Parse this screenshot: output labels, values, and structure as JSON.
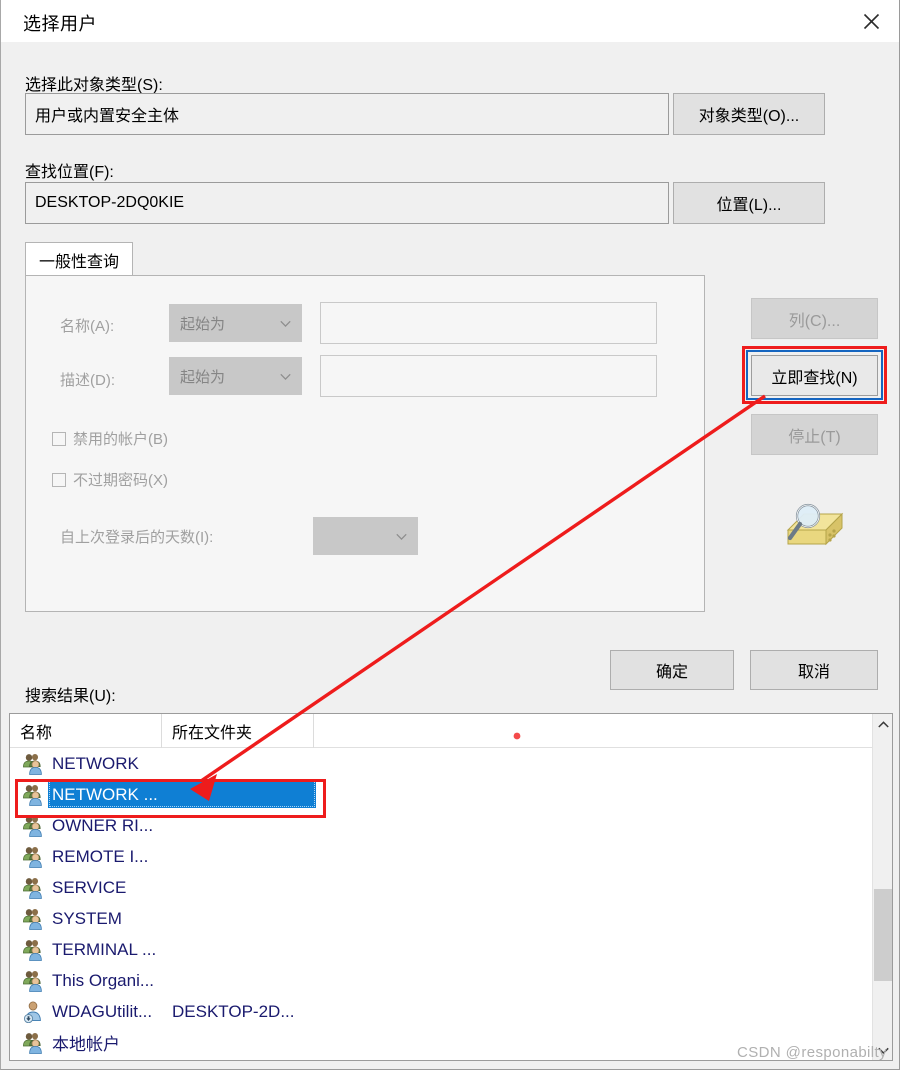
{
  "window": {
    "title": "选择用户",
    "close_icon": "close-icon"
  },
  "object_type": {
    "label": "选择此对象类型(S):",
    "value": "用户或内置安全主体",
    "button": "对象类型(O)..."
  },
  "location": {
    "label": "查找位置(F):",
    "value": "DESKTOP-2DQ0KIE",
    "button": "位置(L)..."
  },
  "query": {
    "tab": "一般性查询",
    "name_label": "名称(A):",
    "name_condition": "起始为",
    "name_value": "",
    "desc_label": "描述(D):",
    "desc_condition": "起始为",
    "desc_value": "",
    "disabled_accounts": "禁用的帐户(B)",
    "non_expiring_password": "不过期密码(X)",
    "days_since_logon_label": "自上次登录后的天数(I):",
    "days_since_logon_value": ""
  },
  "side_buttons": {
    "columns": "列(C)...",
    "find_now": "立即查找(N)",
    "stop": "停止(T)",
    "search_icon": "magnifier-search-icon"
  },
  "footer": {
    "ok": "确定",
    "cancel": "取消"
  },
  "results": {
    "label": "搜索结果(U):",
    "columns": [
      "名称",
      "所在文件夹"
    ],
    "rows": [
      {
        "name": "NETWORK",
        "folder": "",
        "icon": "group-icon",
        "selected": false
      },
      {
        "name": "NETWORK ...",
        "folder": "",
        "icon": "group-icon",
        "selected": true
      },
      {
        "name": "OWNER RI...",
        "folder": "",
        "icon": "group-icon",
        "selected": false
      },
      {
        "name": "REMOTE I...",
        "folder": "",
        "icon": "group-icon",
        "selected": false
      },
      {
        "name": "SERVICE",
        "folder": "",
        "icon": "group-icon",
        "selected": false
      },
      {
        "name": "SYSTEM",
        "folder": "",
        "icon": "group-icon",
        "selected": false
      },
      {
        "name": "TERMINAL ...",
        "folder": "",
        "icon": "group-icon",
        "selected": false
      },
      {
        "name": "This Organi...",
        "folder": "",
        "icon": "group-icon",
        "selected": false
      },
      {
        "name": "WDAGUtilit...",
        "folder": "DESKTOP-2D...",
        "icon": "user-account-icon",
        "selected": false
      },
      {
        "name": "本地帐户",
        "folder": "",
        "icon": "group-icon",
        "selected": false
      }
    ]
  },
  "scrollbar": {
    "up_icon": "chevron-up-icon",
    "down_icon": "chevron-down-icon"
  },
  "annotations": {
    "highlight_color": "#ee1c1c",
    "focus_color": "#1565c0",
    "arrow_from": "立即查找(N)",
    "arrow_to": "NETWORK ..."
  },
  "watermark": "CSDN @responabilty"
}
